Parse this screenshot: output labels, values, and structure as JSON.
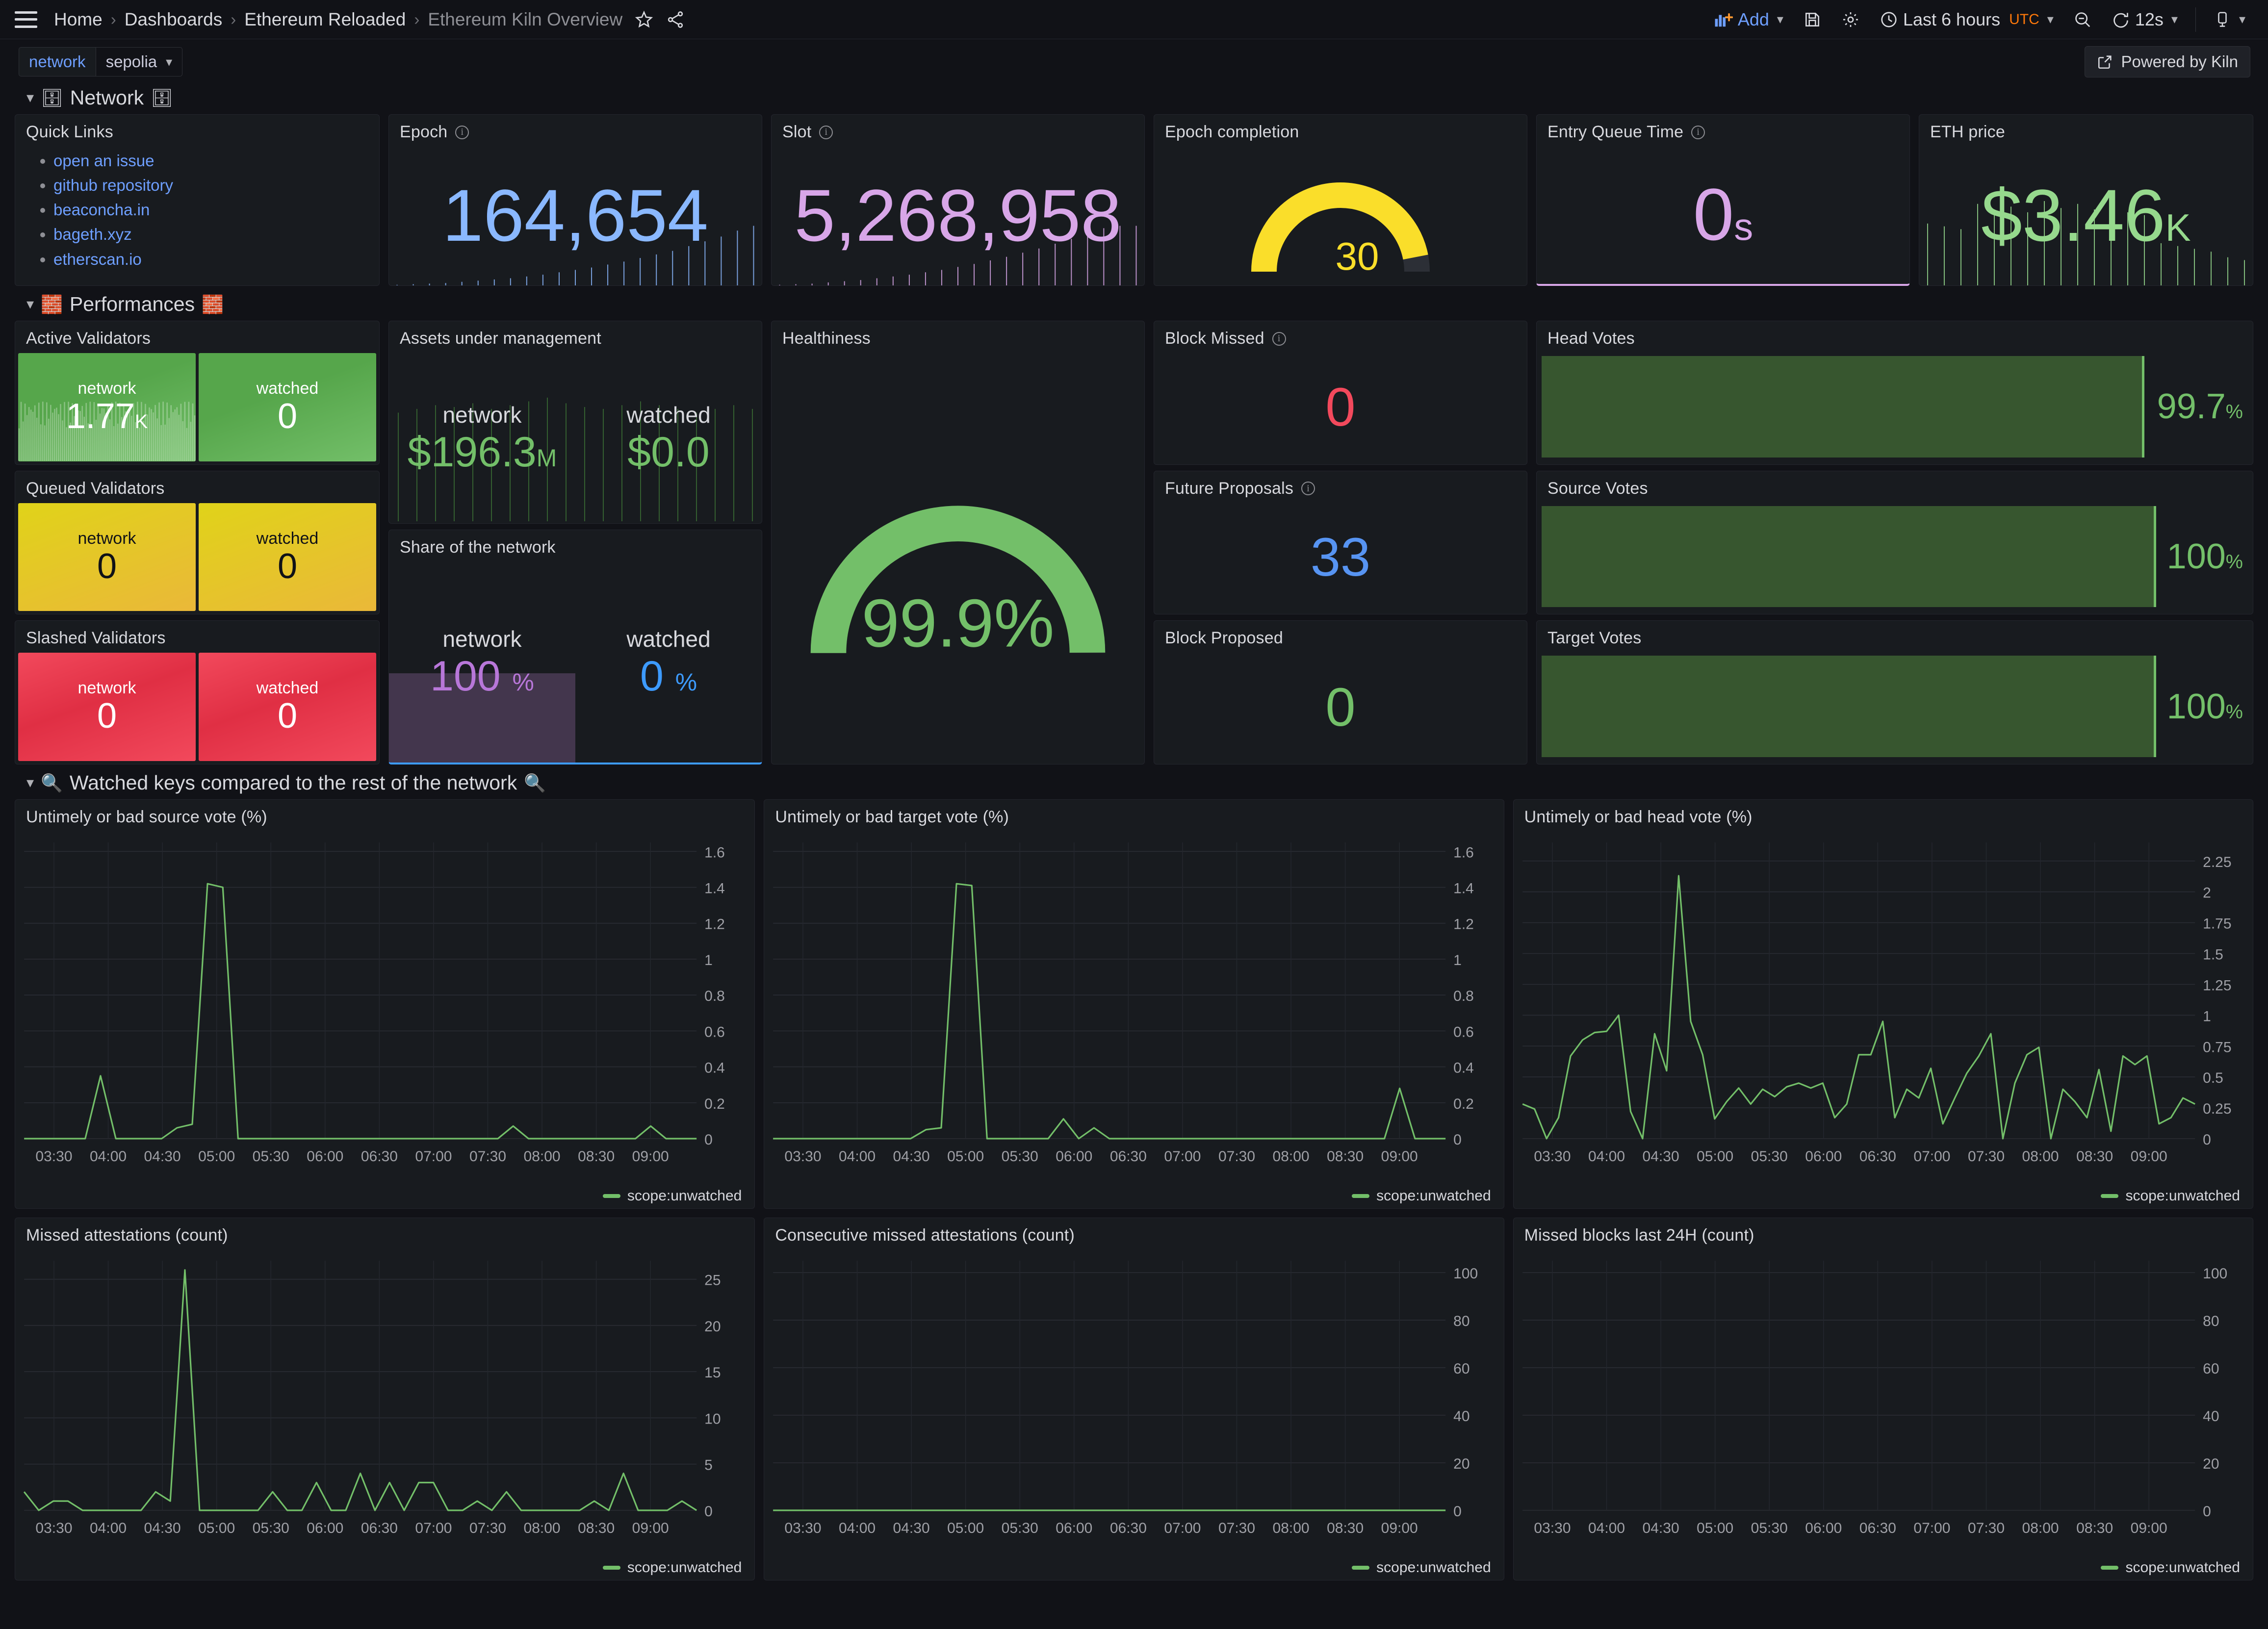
{
  "topnav": {
    "menu_icon": "hamburger-icon",
    "breadcrumbs": [
      "Home",
      "Dashboards",
      "Ethereum Reloaded",
      "Ethereum Kiln Overview"
    ],
    "star_icon": "star-icon",
    "share_icon": "share-icon",
    "add_label": "Add",
    "save_icon": "save-icon",
    "settings_icon": "gear-icon",
    "time_range": "Last 6 hours",
    "timezone": "UTC",
    "zoom_out_icon": "zoom-out-icon",
    "refresh_icon": "refresh-icon",
    "refresh_interval": "12s",
    "kiosk_icon": "tv-icon"
  },
  "variables": {
    "network_label": "network",
    "network_value": "sepolia"
  },
  "kiln_badge": {
    "label": "Powered by Kiln",
    "icon": "external-link-icon"
  },
  "rows": {
    "network": {
      "title": "Network",
      "emoji_left": "🗄",
      "emoji_right": "🗄"
    },
    "performances": {
      "title": "Performances",
      "emoji_left": "🧱",
      "emoji_right": "🧱"
    },
    "watched": {
      "title": "Watched keys compared to the rest of the network",
      "emoji_left": "🔍",
      "emoji_right": "🔍"
    }
  },
  "quick_links": {
    "title": "Quick Links",
    "items": [
      "open an issue",
      "github repository",
      "beaconcha.in",
      "bageth.xyz",
      "etherscan.io"
    ]
  },
  "epoch": {
    "title": "Epoch",
    "value": "164,654",
    "color": "#8ab8ff"
  },
  "slot": {
    "title": "Slot",
    "value": "5,268,958",
    "color": "#d8a6e8"
  },
  "epoch_completion": {
    "title": "Epoch completion",
    "value": "30",
    "max": 32,
    "color": "#fade2a"
  },
  "entry_queue": {
    "title": "Entry Queue Time",
    "value": "0",
    "unit": "s",
    "color": "#d8a6e8"
  },
  "eth_price": {
    "title": "ETH price",
    "value": "$3.46",
    "unit": "K",
    "color": "#96d98d"
  },
  "active_validators": {
    "title": "Active Validators",
    "tiles": [
      {
        "label": "network",
        "value": "1.77",
        "unit": "K",
        "color": "green"
      },
      {
        "label": "watched",
        "value": "0",
        "unit": "",
        "color": "green"
      }
    ]
  },
  "queued_validators": {
    "title": "Queued Validators",
    "tiles": [
      {
        "label": "network",
        "value": "0",
        "unit": "",
        "color": "yellow"
      },
      {
        "label": "watched",
        "value": "0",
        "unit": "",
        "color": "yellow"
      }
    ]
  },
  "slashed_validators": {
    "title": "Slashed Validators",
    "tiles": [
      {
        "label": "network",
        "value": "0",
        "unit": "",
        "color": "red"
      },
      {
        "label": "watched",
        "value": "0",
        "unit": "",
        "color": "red"
      }
    ]
  },
  "assets_under_management": {
    "title": "Assets under management",
    "left_label": "network",
    "left_value": "$196.3",
    "left_unit": "M",
    "right_label": "watched",
    "right_value": "$0.0",
    "right_unit": "",
    "color": "#73bf69"
  },
  "share_of_network": {
    "title": "Share of the network",
    "left_label": "network",
    "left_value": "100",
    "left_unit": "%",
    "left_color": "#b877d9",
    "right_label": "watched",
    "right_value": "0",
    "right_unit": "%",
    "right_color": "#3d9bff"
  },
  "healthiness": {
    "title": "Healthiness",
    "value": "99.9%",
    "percent": 99.9,
    "color": "#73bf69"
  },
  "block_missed": {
    "title": "Block Missed",
    "value": "0",
    "color": "#f2495c"
  },
  "future_proposals": {
    "title": "Future Proposals",
    "value": "33",
    "color": "#5794f2"
  },
  "block_proposed": {
    "title": "Block Proposed",
    "value": "0",
    "color": "#73bf69"
  },
  "head_votes": {
    "title": "Head Votes",
    "value": "99.7",
    "unit": "%",
    "percent": 99.7
  },
  "source_votes": {
    "title": "Source Votes",
    "value": "100",
    "unit": "%",
    "percent": 100
  },
  "target_votes": {
    "title": "Target Votes",
    "value": "100",
    "unit": "%",
    "percent": 100
  },
  "legend_label": "scope:unwatched",
  "chart_data": [
    {
      "id": "untimely_source",
      "type": "line",
      "title": "Untimely or bad source vote (%)",
      "xlabel": "",
      "ylabel": "",
      "legend": [
        "scope:unwatched"
      ],
      "legend_position": "bottom-right",
      "grid": true,
      "xtick_labels": [
        "03:30",
        "04:00",
        "04:30",
        "05:00",
        "05:30",
        "06:00",
        "06:30",
        "07:00",
        "07:30",
        "08:00",
        "08:30",
        "09:00"
      ],
      "ytick_labels": [
        "0",
        "0.2",
        "0.4",
        "0.6",
        "0.8",
        "1",
        "1.2",
        "1.4",
        "1.6"
      ],
      "ylim": [
        0,
        1.65
      ],
      "series": [
        {
          "name": "scope:unwatched",
          "color": "#73bf69",
          "values": [
            0,
            0,
            0,
            0,
            0,
            0.35,
            0,
            0,
            0,
            0,
            0.06,
            0.08,
            1.42,
            1.4,
            0,
            0,
            0,
            0,
            0,
            0,
            0,
            0,
            0,
            0,
            0,
            0,
            0,
            0,
            0,
            0,
            0,
            0,
            0.07,
            0,
            0,
            0,
            0,
            0,
            0,
            0,
            0,
            0.07,
            0,
            0,
            0
          ]
        }
      ]
    },
    {
      "id": "untimely_target",
      "type": "line",
      "title": "Untimely or bad target vote (%)",
      "xlabel": "",
      "ylabel": "",
      "legend": [
        "scope:unwatched"
      ],
      "legend_position": "bottom-right",
      "grid": true,
      "xtick_labels": [
        "03:30",
        "04:00",
        "04:30",
        "05:00",
        "05:30",
        "06:00",
        "06:30",
        "07:00",
        "07:30",
        "08:00",
        "08:30",
        "09:00"
      ],
      "ytick_labels": [
        "0",
        "0.2",
        "0.4",
        "0.6",
        "0.8",
        "1",
        "1.2",
        "1.4",
        "1.6"
      ],
      "ylim": [
        0,
        1.65
      ],
      "series": [
        {
          "name": "scope:unwatched",
          "color": "#73bf69",
          "values": [
            0,
            0,
            0,
            0,
            0,
            0,
            0,
            0,
            0,
            0,
            0.05,
            0.06,
            1.42,
            1.41,
            0,
            0,
            0,
            0,
            0,
            0.11,
            0.0,
            0.06,
            0,
            0,
            0,
            0,
            0,
            0,
            0,
            0,
            0,
            0,
            0,
            0,
            0,
            0,
            0,
            0,
            0,
            0,
            0,
            0.28,
            0,
            0,
            0
          ]
        }
      ]
    },
    {
      "id": "untimely_head",
      "type": "line",
      "title": "Untimely or bad head vote (%)",
      "xlabel": "",
      "ylabel": "",
      "legend": [
        "scope:unwatched"
      ],
      "legend_position": "bottom-right",
      "grid": true,
      "xtick_labels": [
        "03:30",
        "04:00",
        "04:30",
        "05:00",
        "05:30",
        "06:00",
        "06:30",
        "07:00",
        "07:30",
        "08:00",
        "08:30",
        "09:00"
      ],
      "ytick_labels": [
        "0",
        "0.25",
        "0.5",
        "0.75",
        "1",
        "1.25",
        "1.5",
        "1.75",
        "2",
        "2.25"
      ],
      "ylim": [
        0,
        2.4
      ],
      "series": [
        {
          "name": "scope:unwatched",
          "color": "#73bf69",
          "values": [
            0.28,
            0.24,
            0.0,
            0.17,
            0.67,
            0.8,
            0.86,
            0.87,
            1.0,
            0.22,
            0.0,
            0.85,
            0.55,
            2.13,
            0.95,
            0.68,
            0.16,
            0.3,
            0.41,
            0.28,
            0.4,
            0.34,
            0.42,
            0.45,
            0.41,
            0.45,
            0.17,
            0.28,
            0.68,
            0.68,
            0.95,
            0.17,
            0.4,
            0.33,
            0.57,
            0.12,
            0.33,
            0.53,
            0.67,
            0.85,
            0.0,
            0.45,
            0.68,
            0.74,
            0.0,
            0.4,
            0.3,
            0.17,
            0.56,
            0.06,
            0.67,
            0.6,
            0.67,
            0.12,
            0.17,
            0.33,
            0.28
          ]
        }
      ]
    },
    {
      "id": "missed_attestations",
      "type": "line",
      "title": "Missed attestations (count)",
      "xlabel": "",
      "ylabel": "",
      "legend": [
        "scope:unwatched"
      ],
      "legend_position": "bottom-right",
      "grid": true,
      "xtick_labels": [
        "03:30",
        "04:00",
        "04:30",
        "05:00",
        "05:30",
        "06:00",
        "06:30",
        "07:00",
        "07:30",
        "08:00",
        "08:30",
        "09:00"
      ],
      "ytick_labels": [
        "0",
        "5",
        "10",
        "15",
        "20",
        "25"
      ],
      "ylim": [
        0,
        27
      ],
      "series": [
        {
          "name": "scope:unwatched",
          "color": "#73bf69",
          "values": [
            2,
            0,
            1,
            1,
            0,
            0,
            0,
            0,
            0,
            2,
            1,
            26,
            0,
            0,
            0,
            0,
            0,
            2,
            0,
            0,
            3,
            0,
            0,
            4,
            0,
            3,
            0,
            3,
            3,
            0,
            0,
            1,
            0,
            2,
            0,
            0,
            0,
            0,
            0,
            1,
            0,
            4,
            0,
            0,
            0,
            1,
            0
          ]
        }
      ]
    },
    {
      "id": "consecutive_missed_attestations",
      "type": "line",
      "title": "Consecutive missed attestations (count)",
      "xlabel": "",
      "ylabel": "",
      "legend": [
        "scope:unwatched"
      ],
      "legend_position": "bottom-right",
      "grid": true,
      "xtick_labels": [
        "03:30",
        "04:00",
        "04:30",
        "05:00",
        "05:30",
        "06:00",
        "06:30",
        "07:00",
        "07:30",
        "08:00",
        "08:30",
        "09:00"
      ],
      "ytick_labels": [
        "0",
        "20",
        "40",
        "60",
        "80",
        "100"
      ],
      "ylim": [
        0,
        105
      ],
      "series": [
        {
          "name": "scope:unwatched",
          "color": "#73bf69",
          "values": [
            0,
            0,
            0,
            0,
            0,
            0,
            0,
            0,
            0,
            0,
            0,
            0,
            0,
            0,
            0,
            0,
            0,
            0,
            0,
            0,
            0,
            0,
            0,
            0,
            0
          ]
        }
      ]
    },
    {
      "id": "missed_blocks_24h",
      "type": "line",
      "title": "Missed blocks last 24H (count)",
      "xlabel": "",
      "ylabel": "",
      "legend": [
        "scope:unwatched"
      ],
      "legend_position": "bottom-right",
      "grid": true,
      "xtick_labels": [
        "03:30",
        "04:00",
        "04:30",
        "05:00",
        "05:30",
        "06:00",
        "06:30",
        "07:00",
        "07:30",
        "08:00",
        "08:30",
        "09:00"
      ],
      "ytick_labels": [
        "0",
        "20",
        "40",
        "60",
        "80",
        "100"
      ],
      "ylim": [
        0,
        105
      ],
      "series": [
        {
          "name": "scope:unwatched",
          "color": "#73bf69",
          "values": []
        }
      ]
    }
  ],
  "sparklines": {
    "epoch": [
      1,
      2,
      3,
      4,
      6,
      8,
      10,
      12,
      15,
      18,
      22,
      26,
      30,
      35,
      40,
      46,
      52,
      58,
      66,
      74,
      82,
      92,
      100
    ],
    "slot": [
      1,
      2,
      3,
      5,
      7,
      9,
      12,
      15,
      18,
      22,
      26,
      31,
      36,
      42,
      48,
      55,
      62,
      70,
      78,
      87,
      96,
      100,
      100
    ],
    "eth_price": [
      44,
      42,
      40,
      58,
      54,
      56,
      52,
      60,
      55,
      58,
      54,
      56,
      52,
      50,
      30,
      28,
      26,
      24,
      20,
      18
    ],
    "aum": [
      58,
      60,
      62,
      61,
      63,
      60,
      62,
      64,
      66,
      63,
      61,
      60,
      62,
      64,
      62,
      60,
      58,
      60,
      62,
      60
    ]
  }
}
